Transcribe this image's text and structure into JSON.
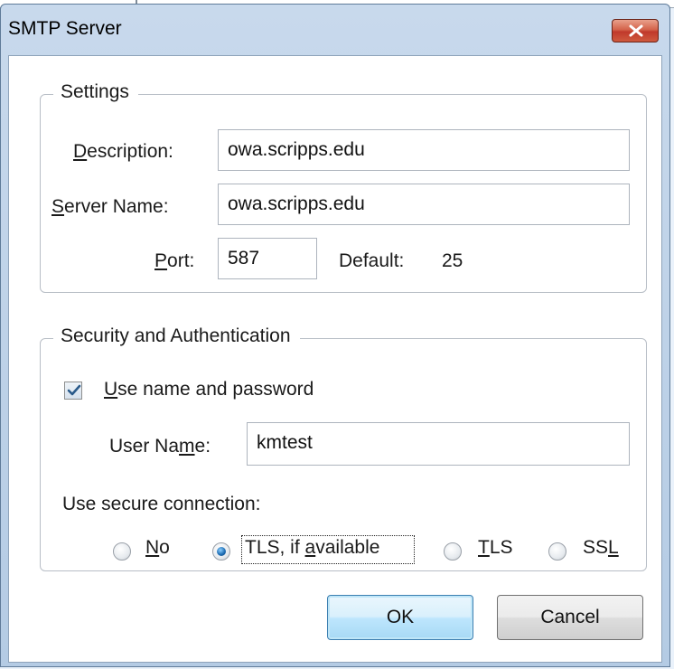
{
  "dialog": {
    "title": "SMTP Server"
  },
  "settings": {
    "group_title": "Settings",
    "description_label": {
      "pre": "",
      "u": "D",
      "post": "escription:"
    },
    "description_value": "owa.scripps.edu",
    "server_name_label": {
      "pre": "",
      "u": "S",
      "post": "erver Name:"
    },
    "server_name_value": "owa.scripps.edu",
    "port_label": {
      "pre": "",
      "u": "P",
      "post": "ort:"
    },
    "port_value": "587",
    "default_label": "Default:",
    "default_value": "25"
  },
  "security": {
    "group_title": "Security and Authentication",
    "use_name_password": {
      "pre": "",
      "u": "U",
      "post": "se name and password",
      "checked": true
    },
    "user_name_label": {
      "pre": "User Na",
      "u": "m",
      "post": "e:"
    },
    "user_name_value": "kmtest",
    "secure_connection_label": "Use secure connection:",
    "options": [
      {
        "pre": "",
        "u": "N",
        "post": "o",
        "checked": false
      },
      {
        "pre": "TLS, if ",
        "u": "a",
        "post": "vailable",
        "checked": true
      },
      {
        "pre": "",
        "u": "T",
        "post": "LS",
        "checked": false
      },
      {
        "pre": "SS",
        "u": "L",
        "post": "",
        "checked": false
      }
    ]
  },
  "buttons": {
    "ok": "OK",
    "cancel": "Cancel"
  },
  "colors": {
    "titlebar": "#c8d9ec",
    "close_button": "#c0392b",
    "default_button_border": "#3c7fb1"
  }
}
